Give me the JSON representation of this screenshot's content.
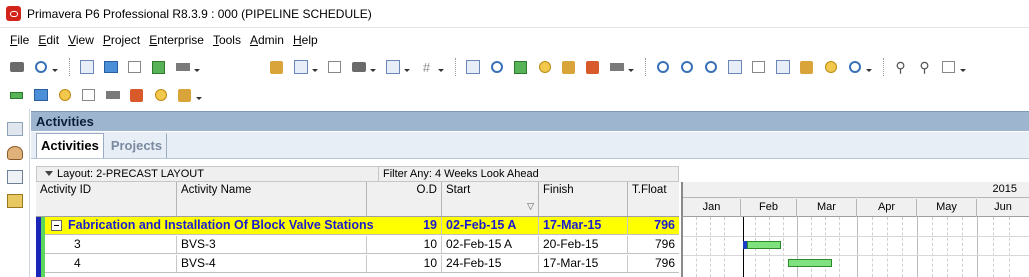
{
  "window": {
    "title": "Primavera P6 Professional R8.3.9 : 000 (PIPELINE SCHEDULE)"
  },
  "menu": [
    "File",
    "Edit",
    "View",
    "Project",
    "Enterprise",
    "Tools",
    "Admin",
    "Help"
  ],
  "panel": {
    "title": "Activities"
  },
  "tabs": [
    {
      "label": "Activities",
      "active": true
    },
    {
      "label": "Projects",
      "active": false
    }
  ],
  "layout_bar": {
    "layout": "Layout: 2-PRECAST LAYOUT",
    "filter": "Filter Any: 4 Weeks Look Ahead"
  },
  "columns": [
    "Activity ID",
    "Activity Name",
    "O.D",
    "Start",
    "Finish",
    "T.Float"
  ],
  "rows": [
    {
      "type": "wbs",
      "id": "",
      "name": "Fabrication and Installation Of Block Valve Stations",
      "od": "19",
      "start": "02-Feb-15 A",
      "finish": "17-Mar-15",
      "tfloat": "796"
    },
    {
      "type": "activity",
      "id": "3",
      "name": "BVS-3",
      "od": "10",
      "start": "02-Feb-15 A",
      "finish": "20-Feb-15",
      "tfloat": "796"
    },
    {
      "type": "activity",
      "id": "4",
      "name": "BVS-4",
      "od": "10",
      "start": "24-Feb-15",
      "finish": "17-Mar-15",
      "tfloat": "796"
    }
  ],
  "gantt": {
    "year": "2015",
    "months": [
      "Jan",
      "Feb",
      "Mar",
      "Apr",
      "May",
      "Jun"
    ]
  },
  "colors": {
    "wbs_band": "#ffff00",
    "wbs_text": "#1b1bd2",
    "bar": "#7fe27f",
    "actual": "#1a3cc6",
    "header": "#9eb5d0"
  }
}
